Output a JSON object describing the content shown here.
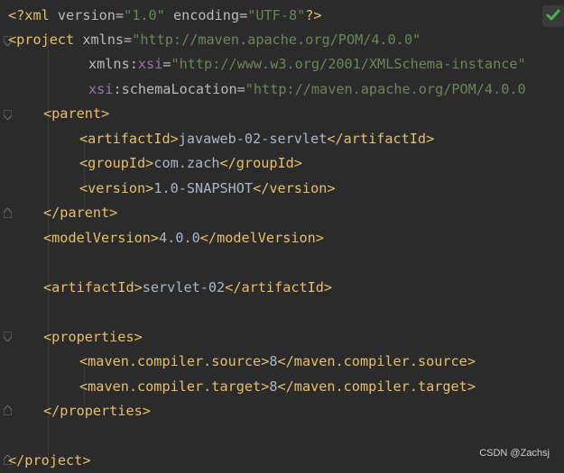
{
  "editor": {
    "lines": [
      [
        "<?",
        "xml",
        " ",
        "version",
        "=",
        "\"1.0\"",
        " ",
        "encoding",
        "=",
        "\"UTF-8\"",
        "?>"
      ],
      [
        "<",
        "project",
        " ",
        "xmlns",
        "=",
        "\"http://maven.apache.org/POM/4.0.0\""
      ],
      [
        "xmlns",
        ":",
        "xsi",
        "=",
        "\"http://www.w3.org/2001/XMLSchema-instance\""
      ],
      [
        "xsi",
        ":",
        "schemaLocation",
        "=",
        "\"http://maven.apache.org/POM/4.0.0"
      ],
      [
        "<",
        "parent",
        ">"
      ],
      [
        "<",
        "artifactId",
        ">",
        "javaweb-02-servlet",
        "</",
        "artifactId",
        ">"
      ],
      [
        "<",
        "groupId",
        ">",
        "com.zach",
        "</",
        "groupId",
        ">"
      ],
      [
        "<",
        "version",
        ">",
        "1.0-SNAPSHOT",
        "</",
        "version",
        ">"
      ],
      [
        "</",
        "parent",
        ">"
      ],
      [
        "<",
        "modelVersion",
        ">",
        "4.0.0",
        "</",
        "modelVersion",
        ">"
      ],
      [
        "<",
        "artifactId",
        ">",
        "servlet-02",
        "</",
        "artifactId",
        ">"
      ],
      [
        "<",
        "properties",
        ">"
      ],
      [
        "<",
        "maven.compiler.source",
        ">",
        "8",
        "</",
        "maven.compiler.source",
        ">"
      ],
      [
        "<",
        "maven.compiler.target",
        ">",
        "8",
        "</",
        "maven.compiler.target",
        ">"
      ],
      [
        "</",
        "properties",
        ">"
      ],
      [
        "</",
        "project",
        ">"
      ]
    ]
  },
  "status": {
    "check_icon": "checkmark-icon",
    "check_color": "#4caf50"
  },
  "watermark": {
    "text": "CSDN @Zachsj"
  },
  "colors": {
    "background": "#2b2b2b",
    "tag": "#e8bf6a",
    "attr": "#bababa",
    "namespace": "#9876aa",
    "value": "#6a8759",
    "text": "#a9b7c6"
  }
}
